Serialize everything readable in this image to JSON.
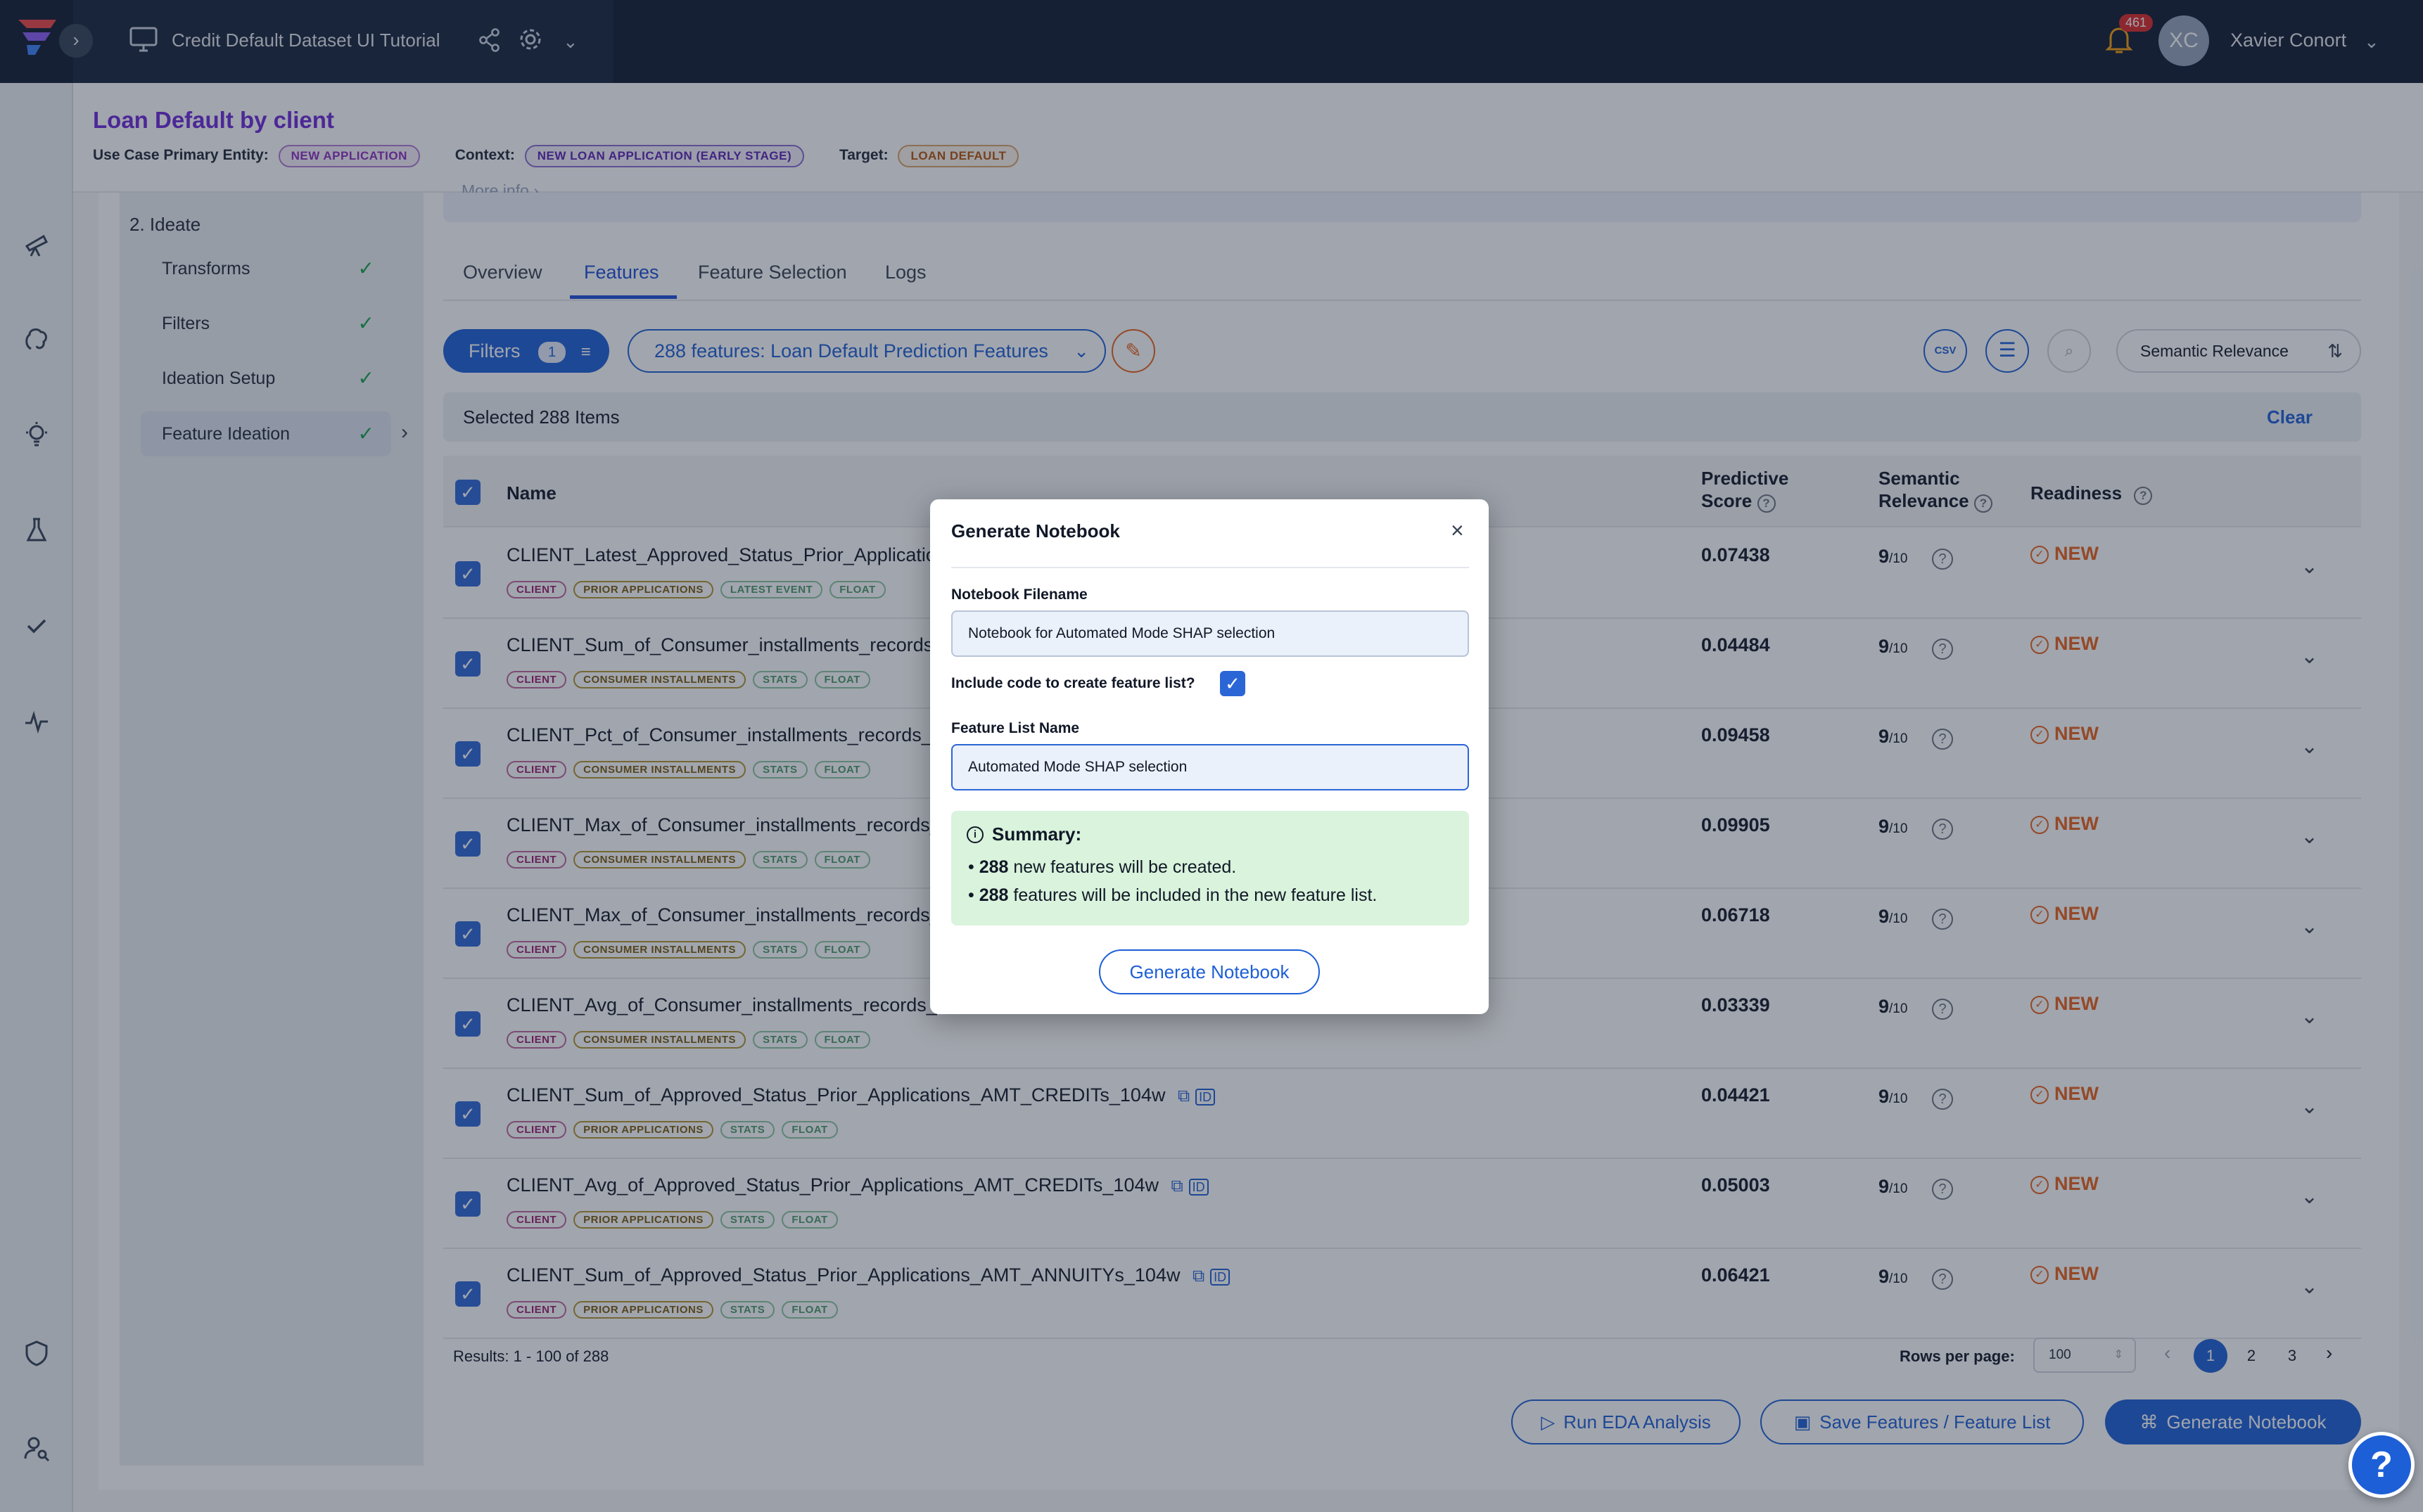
{
  "topbar": {
    "project_title": "Credit Default Dataset UI Tutorial",
    "notification_count": "461",
    "user_initials": "XC",
    "user_name": "Xavier Conort"
  },
  "header": {
    "title": "Loan Default by client",
    "entity_label": "Use Case Primary Entity:",
    "entity_value": "NEW APPLICATION",
    "context_label": "Context:",
    "context_value": "NEW LOAN APPLICATION (EARLY STAGE)",
    "target_label": "Target:",
    "target_value": "LOAN DEFAULT"
  },
  "steps": {
    "more_info": "More info",
    "section": "2. Ideate",
    "items": [
      {
        "label": "Transforms"
      },
      {
        "label": "Filters"
      },
      {
        "label": "Ideation Setup"
      },
      {
        "label": "Feature Ideation"
      }
    ]
  },
  "tabs": [
    {
      "label": "Overview"
    },
    {
      "label": "Features"
    },
    {
      "label": "Feature Selection"
    },
    {
      "label": "Logs"
    }
  ],
  "toolbar": {
    "filters_label": "Filters",
    "filters_count": "1",
    "feature_list": "288 features: Loan Default Prediction Features",
    "sort_label": "Semantic Relevance"
  },
  "selection": {
    "text": "Selected 288 Items",
    "clear_label": "Clear"
  },
  "table": {
    "headers": {
      "name": "Name",
      "predictive_score": "Predictive Score",
      "semantic_relevance": "Semantic Relevance",
      "readiness": "Readiness"
    },
    "rows": [
      {
        "name": "CLIENT_Latest_Approved_Status_Prior_Applicatio",
        "tags": [
          "CLIENT",
          "PRIOR APPLICATIONS",
          "LATEST EVENT",
          "FLOAT"
        ],
        "score": "0.07438",
        "relevance": "9",
        "relevance_denom": "/10",
        "readiness": "NEW"
      },
      {
        "name": "CLIENT_Sum_of_Consumer_installments_records_",
        "tags": [
          "CLIENT",
          "CONSUMER INSTALLMENTS",
          "STATS",
          "FLOAT"
        ],
        "score": "0.04484",
        "relevance": "9",
        "relevance_denom": "/10",
        "readiness": "NEW"
      },
      {
        "name": "CLIENT_Pct_of_Consumer_installments_records_i",
        "tags": [
          "CLIENT",
          "CONSUMER INSTALLMENTS",
          "STATS",
          "FLOAT"
        ],
        "score": "0.09458",
        "relevance": "9",
        "relevance_denom": "/10",
        "readiness": "NEW"
      },
      {
        "name": "CLIENT_Max_of_Consumer_installments_records_",
        "tags": [
          "CLIENT",
          "CONSUMER INSTALLMENTS",
          "STATS",
          "FLOAT"
        ],
        "score": "0.09905",
        "relevance": "9",
        "relevance_denom": "/10",
        "readiness": "NEW"
      },
      {
        "name": "CLIENT_Max_of_Consumer_installments_records_",
        "tags": [
          "CLIENT",
          "CONSUMER INSTALLMENTS",
          "STATS",
          "FLOAT"
        ],
        "score": "0.06718",
        "relevance": "9",
        "relevance_denom": "/10",
        "readiness": "NEW"
      },
      {
        "name": "CLIENT_Avg_of_Consumer_installments_records_",
        "tags": [
          "CLIENT",
          "CONSUMER INSTALLMENTS",
          "STATS",
          "FLOAT"
        ],
        "score": "0.03339",
        "relevance": "9",
        "relevance_denom": "/10",
        "readiness": "NEW"
      },
      {
        "name": "CLIENT_Sum_of_Approved_Status_Prior_Applications_AMT_CREDITs_104w",
        "tags": [
          "CLIENT",
          "PRIOR APPLICATIONS",
          "STATS",
          "FLOAT"
        ],
        "score": "0.04421",
        "relevance": "9",
        "relevance_denom": "/10",
        "readiness": "NEW"
      },
      {
        "name": "CLIENT_Avg_of_Approved_Status_Prior_Applications_AMT_CREDITs_104w",
        "tags": [
          "CLIENT",
          "PRIOR APPLICATIONS",
          "STATS",
          "FLOAT"
        ],
        "score": "0.05003",
        "relevance": "9",
        "relevance_denom": "/10",
        "readiness": "NEW"
      },
      {
        "name": "CLIENT_Sum_of_Approved_Status_Prior_Applications_AMT_ANNUITYs_104w",
        "tags": [
          "CLIENT",
          "PRIOR APPLICATIONS",
          "STATS",
          "FLOAT"
        ],
        "score": "0.06421",
        "relevance": "9",
        "relevance_denom": "/10",
        "readiness": "NEW"
      }
    ]
  },
  "footer": {
    "results": "Results: 1 - 100 of 288",
    "rows_per_page_label": "Rows per page:",
    "rows_per_page_value": "100",
    "pages": [
      "1",
      "2",
      "3"
    ],
    "run_eda": "Run EDA Analysis",
    "save_features": "Save Features / Feature List",
    "generate_notebook": "Generate Notebook"
  },
  "modal": {
    "title": "Generate Notebook",
    "filename_label": "Notebook Filename",
    "filename_value": "Notebook for Automated Mode SHAP selection",
    "include_label": "Include code to create feature list?",
    "include_checked": true,
    "list_name_label": "Feature List Name",
    "list_name_value": "Automated Mode SHAP selection",
    "summary_title": "Summary:",
    "summary_new_count": "288",
    "summary_new_text": "new features will be created.",
    "summary_included_count": "288",
    "summary_included_text": "features will be included in the new feature list.",
    "submit_label": "Generate Notebook"
  },
  "help_button": "?",
  "colors": {
    "topbar": "#0f1b30",
    "accent": "#1d5fd6",
    "title_purple": "#6d28d9",
    "new_orange": "#e8611a",
    "summary_green": "#d9f3dc"
  }
}
